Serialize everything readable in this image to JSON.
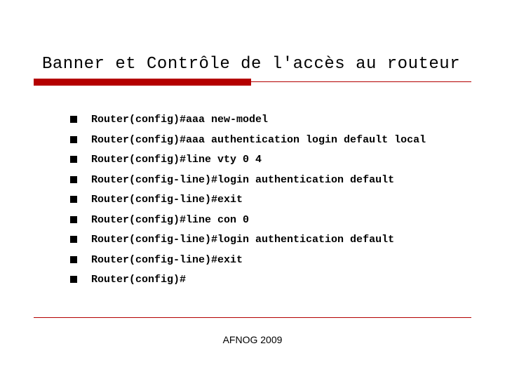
{
  "title": "Banner et Contrôle de l'accès au routeur",
  "items": [
    "Router(config)#aaa new-model",
    "Router(config)#aaa authentication login default local",
    "Router(config)#line vty 0 4",
    "Router(config-line)#login authentication default",
    "Router(config-line)#exit",
    "Router(config)#line con 0",
    "Router(config-line)#login authentication default",
    "Router(config-line)#exit",
    "Router(config)#"
  ],
  "footer": "AFNOG 2009"
}
